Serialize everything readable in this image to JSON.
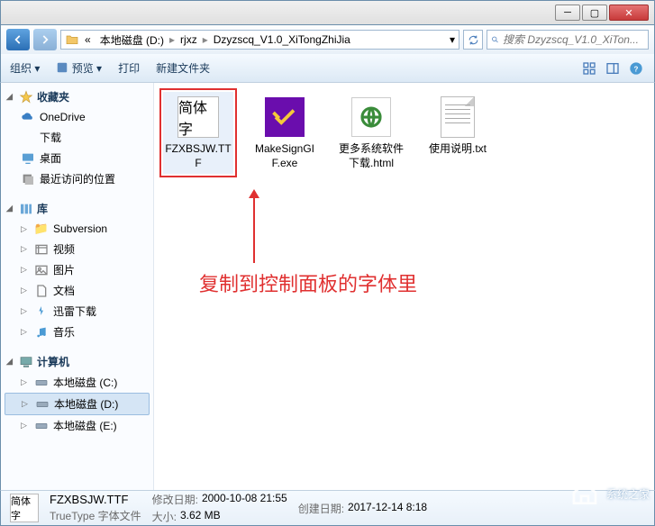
{
  "breadcrumb": {
    "prefix": "«",
    "parts": [
      "本地磁盘 (D:)",
      "rjxz",
      "Dzyzscq_V1.0_XiTongZhiJia"
    ]
  },
  "search": {
    "placeholder": "搜索 Dzyzscq_V1.0_XiTon..."
  },
  "toolbar": {
    "organize": "组织 ▾",
    "preview": "预览 ▾",
    "print": "打印",
    "newfolder": "新建文件夹"
  },
  "sidebar": {
    "favorites": {
      "label": "收藏夹",
      "items": [
        "OneDrive",
        "下载",
        "桌面",
        "最近访问的位置"
      ]
    },
    "libraries": {
      "label": "库",
      "items": [
        "Subversion",
        "视频",
        "图片",
        "文档",
        "迅雷下载",
        "音乐"
      ]
    },
    "computer": {
      "label": "计算机",
      "items": [
        "本地磁盘 (C:)",
        "本地磁盘 (D:)",
        "本地磁盘 (E:)"
      ]
    }
  },
  "files": [
    {
      "name": "FZXBSJW.TTF",
      "tile": "简体字",
      "type": "font",
      "selected": true
    },
    {
      "name": "MakeSignGIF.exe",
      "type": "gif"
    },
    {
      "name": "更多系统软件下载.html",
      "type": "html"
    },
    {
      "name": "使用说明.txt",
      "type": "txt"
    }
  ],
  "annotation": "复制到控制面板的字体里",
  "details": {
    "thumb": "简体字",
    "name": "FZXBSJW.TTF",
    "type": "TrueType 字体文件",
    "mod_label": "修改日期:",
    "mod": "2000-10-08 21:55",
    "create_label": "创建日期:",
    "create": "2017-12-14 8:18",
    "size_label": "大小:",
    "size": "3.62 MB"
  },
  "watermark": "系统之家"
}
